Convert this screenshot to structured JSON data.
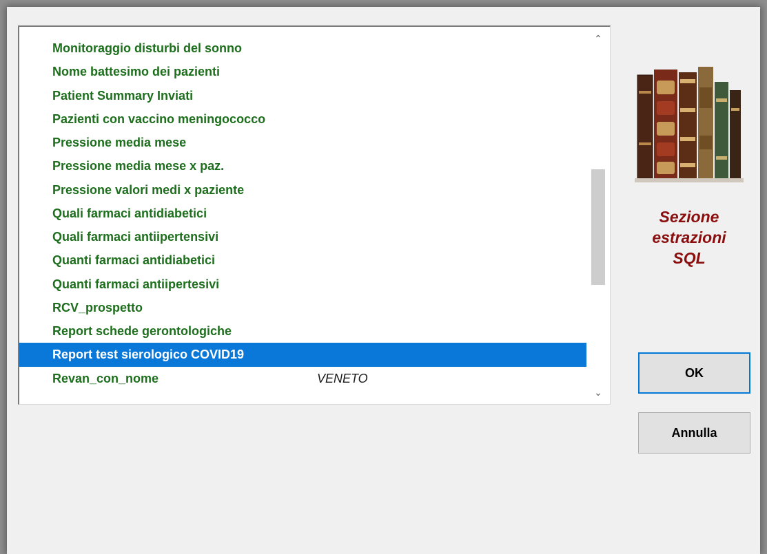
{
  "list": {
    "items": [
      {
        "label": "Monitoraggio disturbi del sonno",
        "region": ""
      },
      {
        "label": "Nome battesimo dei pazienti",
        "region": ""
      },
      {
        "label": "Patient Summary Inviati",
        "region": ""
      },
      {
        "label": "Pazienti con vaccino meningococco",
        "region": ""
      },
      {
        "label": "Pressione media mese",
        "region": ""
      },
      {
        "label": "Pressione media mese x paz.",
        "region": ""
      },
      {
        "label": "Pressione valori medi x paziente",
        "region": ""
      },
      {
        "label": "Quali farmaci antidiabetici",
        "region": ""
      },
      {
        "label": "Quali farmaci antiipertensivi",
        "region": ""
      },
      {
        "label": "Quanti farmaci antidiabetici",
        "region": ""
      },
      {
        "label": "Quanti farmaci antiipertesivi",
        "region": ""
      },
      {
        "label": "RCV_prospetto",
        "region": ""
      },
      {
        "label": "Report schede gerontologiche",
        "region": ""
      },
      {
        "label": "Report test sierologico COVID19",
        "region": "",
        "selected": true
      },
      {
        "label": "Revan_con_nome",
        "region": "VENETO"
      }
    ],
    "selected_index": 13,
    "scroll": {
      "thumb_start_fraction": 0.36,
      "thumb_size_fraction": 0.35
    }
  },
  "panel": {
    "title_line1": "Sezione",
    "title_line2": "estrazioni",
    "title_line3": "SQL",
    "image_icon": "books-icon"
  },
  "buttons": {
    "ok_label": "OK",
    "cancel_label": "Annulla"
  },
  "colors": {
    "item_text": "#1d6e1d",
    "selection": "#0a78d8",
    "title": "#8b0e0e",
    "default_button_border": "#0078d7"
  }
}
